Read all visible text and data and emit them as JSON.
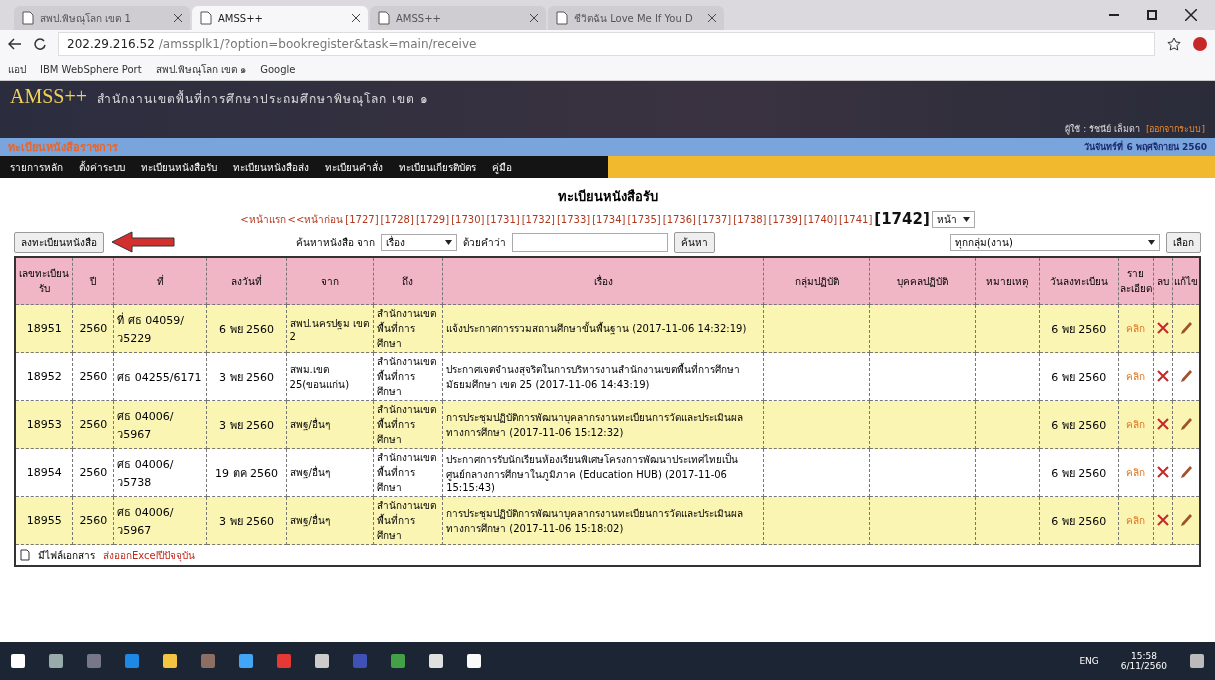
{
  "browser": {
    "tabs": [
      {
        "label": "สพป.พิษณุโลก เขต 1",
        "selected": false
      },
      {
        "label": "AMSS++",
        "selected": true
      },
      {
        "label": "AMSS++",
        "selected": false
      },
      {
        "label": "ชีวิตฉัน Love Me If You D",
        "selected": false
      }
    ],
    "url_host": "202.29.216.52",
    "url_path": "/amssplk1/?option=bookregister&task=main/receive",
    "bookmarks": [
      "แอป",
      "IBM WebSphere Port",
      "สพป.พิษณุโลก เขต ๑",
      "Google"
    ]
  },
  "header": {
    "logo": "AMSS++",
    "org": "สำนักงานเขตพื้นที่การศึกษาประถมศึกษาพิษณุโลก เขต ๑",
    "section": "ทะเบียนหนังสือราชการ",
    "user": "ผู้ใช้ : รัชนีย์ เล็มดา",
    "logout": "[ออกจากระบบ]",
    "date": "วันจันทร์ที่ 6 พฤศจิกายน 2560"
  },
  "menu": [
    "รายการหลัก",
    "ตั้งค่าระบบ",
    "ทะเบียนหนังสือรับ",
    "ทะเบียนหนังสือส่ง",
    "ทะเบียนคำสั่ง",
    "ทะเบียนเกียรติบัตร",
    "คู่มือ"
  ],
  "page_title": "ทะเบียนหนังสือรับ",
  "pagination": {
    "first": "<หน้าแรก",
    "prev": "<<หน้าก่อน",
    "pages": [
      {
        "label": "[1727]",
        "selected": false
      },
      {
        "label": "[1728]",
        "selected": false
      },
      {
        "label": "[1729]",
        "selected": false
      },
      {
        "label": "[1730]",
        "selected": false
      },
      {
        "label": "[1731]",
        "selected": false
      },
      {
        "label": "[1732]",
        "selected": false
      },
      {
        "label": "[1733]",
        "selected": false
      },
      {
        "label": "[1734]",
        "selected": false
      },
      {
        "label": "[1735]",
        "selected": false
      },
      {
        "label": "[1736]",
        "selected": false
      },
      {
        "label": "[1737]",
        "selected": false
      },
      {
        "label": "[1738]",
        "selected": false
      },
      {
        "label": "[1739]",
        "selected": false
      },
      {
        "label": "[1740]",
        "selected": false
      },
      {
        "label": "[1741]",
        "selected": false
      },
      {
        "label": "[1742]",
        "selected": true
      }
    ],
    "page_select": "หน้า"
  },
  "toolbar": {
    "register_button": "ลงทะเบียนหนังสือ",
    "search_label": "ค้นหาหนังสือ จาก",
    "search_field_select": "เรื่อง",
    "keyword_label": "ด้วยคำว่า",
    "search_button": "ค้นหา",
    "group_select": "ทุกกลุ่ม(งาน)",
    "choose_button": "เลือก"
  },
  "table": {
    "columns": [
      "เลขทะเบียนรับ",
      "ปี",
      "ที่",
      "ลงวันที่",
      "จาก",
      "ถึง",
      "เรื่อง",
      "กลุ่มปฏิบัติ",
      "บุคคลปฏิบัติ",
      "หมายเหตุ",
      "วันลงทะเบียน",
      "รายละเอียด",
      "ลบ",
      "แก้ไข"
    ],
    "rows": [
      {
        "no": "18951",
        "year": "2560",
        "ref": "ที่ ศธ 04059/ ว5229",
        "dated": "6 พย 2560",
        "from": "สพป.นครปฐม เขต 2",
        "to": "สำนักงานเขตพื้นที่การศึกษา",
        "subject": "แจ้งประกาศการรวมสถานศึกษาขั้นพื้นฐาน (2017-11-06 14:32:19)",
        "registered": "6 พย 2560",
        "detail": "คลิก"
      },
      {
        "no": "18952",
        "year": "2560",
        "ref": "ศธ 04255/6171",
        "dated": "3 พย 2560",
        "from": "สพม.เขต 25(ขอนแก่น)",
        "to": "สำนักงานเขตพื้นที่การศึกษา",
        "subject": "ประกาศเจตจำนงสุจริตในการบริหารงานสำนักงานเขตพื้นที่การศึกษามัธยมศึกษา เขต 25 (2017-11-06 14:43:19)",
        "registered": "6 พย 2560",
        "detail": "คลิก"
      },
      {
        "no": "18953",
        "year": "2560",
        "ref": "ศธ 04006/ว5967",
        "dated": "3 พย 2560",
        "from": "สพฐ/อื่นๆ",
        "to": "สำนักงานเขตพื้นที่การศึกษา",
        "subject": "การประชุมปฏิบัติการพัฒนาบุคลากรงานทะเบียนการวัดและประเมินผลทางการศึกษา (2017-11-06 15:12:32)",
        "registered": "6 พย 2560",
        "detail": "คลิก"
      },
      {
        "no": "18954",
        "year": "2560",
        "ref": "ศธ 04006/ว5738",
        "dated": "19 ตค 2560",
        "from": "สพฐ/อื่นๆ",
        "to": "สำนักงานเขตพื้นที่การศึกษา",
        "subject": "ประกาศการรับนักเรียนห้องเรียนพิเศษโครงการพัฒนาประเทศไทยเป็นศูนย์กลางการศึกษาในภูมิภาค (Education HUB) (2017-11-06 15:15:43)",
        "registered": "6 พย 2560",
        "detail": "คลิก"
      },
      {
        "no": "18955",
        "year": "2560",
        "ref": "ศธ 04006/ว5967",
        "dated": "3 พย 2560",
        "from": "สพฐ/อื่นๆ",
        "to": "สำนักงานเขตพื้นที่การศึกษา",
        "subject": "การประชุมปฏิบัติการพัฒนาบุคลากรงานทะเบียนการวัดและประเมินผลทางการศึกษา (2017-11-06 15:18:02)",
        "registered": "6 พย 2560",
        "detail": "คลิก"
      }
    ],
    "footer_note": "มีไฟล์เอกสาร",
    "export_link": "ส่งออกExcelปีปัจจุบัน"
  },
  "taskbar": {
    "language": "ENG",
    "time": "15:58",
    "date": "6/11/2560"
  }
}
